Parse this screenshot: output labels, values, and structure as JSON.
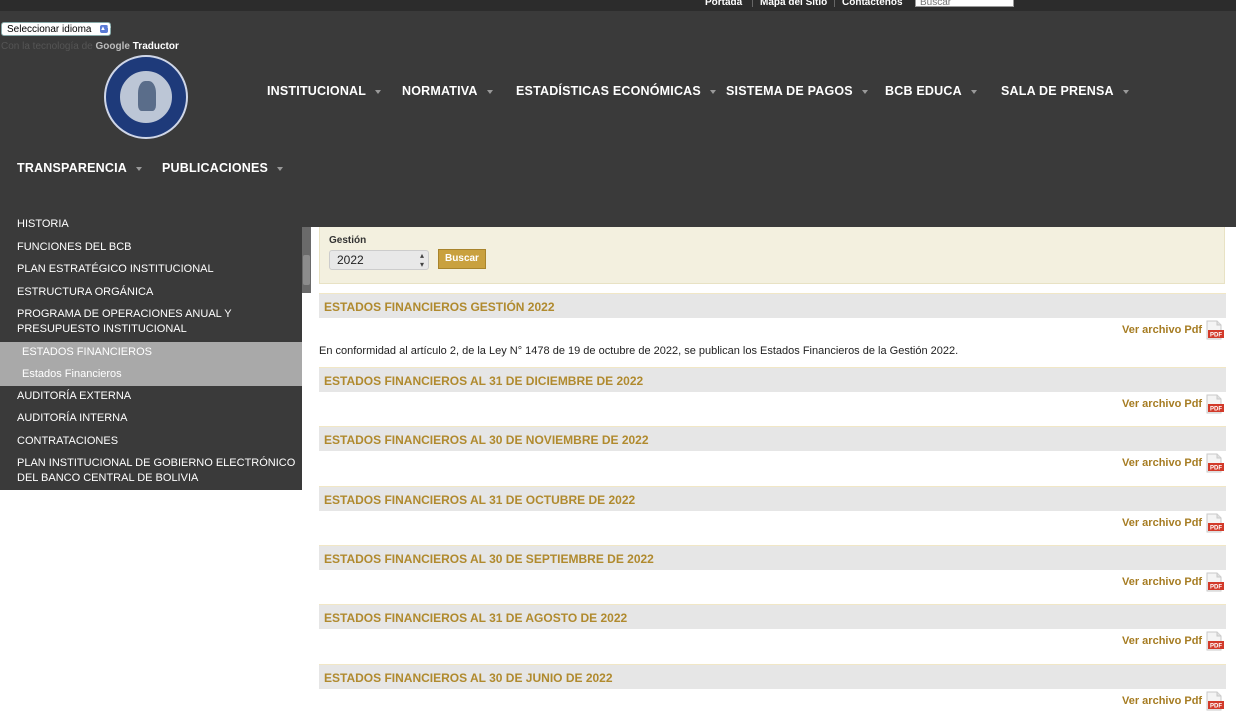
{
  "topbar": {
    "links": [
      "Portada",
      "Mapa del Sitio",
      "Contáctenos"
    ],
    "search_placeholder": "Buscar"
  },
  "translate": {
    "select_label": "Seleccionar idioma",
    "powered_prefix": "Con la tecnología de",
    "google": "Google",
    "translator": "Traductor"
  },
  "nav": {
    "row1": [
      "INSTITUCIONAL",
      "NORMATIVA",
      "ESTADÍSTICAS ECONÓMICAS",
      "SISTEMA DE PAGOS",
      "BCB EDUCA",
      "SALA DE PRENSA"
    ],
    "row2": [
      "TRANSPARENCIA",
      "PUBLICACIONES"
    ]
  },
  "sidebar": {
    "items": [
      "HISTORIA",
      "FUNCIONES DEL BCB",
      "PLAN ESTRATÉGICO INSTITUCIONAL",
      "ESTRUCTURA ORGÁNICA",
      "PROGRAMA DE OPERACIONES ANUAL Y PRESUPUESTO INSTITUCIONAL",
      "AUDITORÍA EXTERNA",
      "AUDITORÍA INTERNA",
      "CONTRATACIONES",
      "PLAN INSTITUCIONAL DE GOBIERNO ELECTRÓNICO DEL BANCO CENTRAL DE BOLIVIA"
    ],
    "active_parent": "ESTADOS FINANCIEROS",
    "active_child": "Estados Financieros"
  },
  "filter": {
    "label": "Gestión",
    "year": "2022",
    "button": "Buscar"
  },
  "content": {
    "view_label": "Ver archivo Pdf",
    "pdf_icon_text": "PDF",
    "description": "En conformidad al artículo 2, de la Ley N° 1478 de 19 de octubre de 2022, se publican los Estados Financieros de la Gestión 2022.",
    "sections": [
      "ESTADOS FINANCIEROS GESTIÓN 2022",
      "ESTADOS FINANCIEROS AL 31 DE DICIEMBRE DE 2022",
      "ESTADOS FINANCIEROS AL 30 DE NOVIEMBRE DE 2022",
      "ESTADOS FINANCIEROS AL 31 DE OCTUBRE DE 2022",
      "ESTADOS FINANCIEROS AL 30 DE SEPTIEMBRE DE 2022",
      "ESTADOS FINANCIEROS AL 31 DE AGOSTO DE 2022",
      "ESTADOS FINANCIEROS AL 30 DE JUNIO DE 2022"
    ]
  }
}
